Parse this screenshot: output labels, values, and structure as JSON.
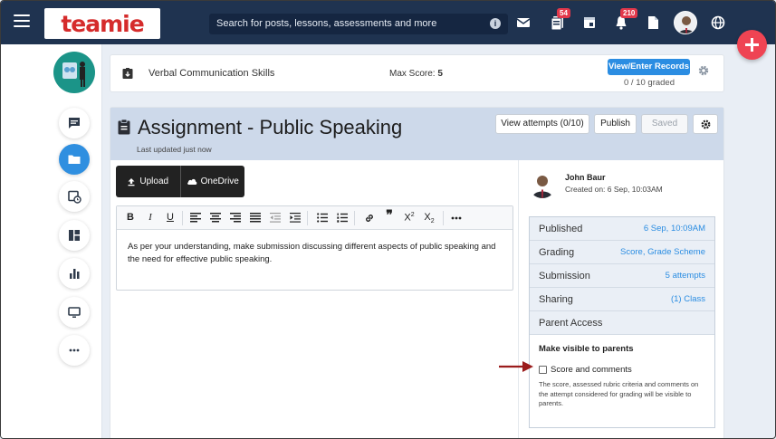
{
  "topbar": {
    "logo_text": "teamie",
    "search_placeholder": "Search for posts, lessons, assessments and more",
    "search_info_glyph": "i",
    "icons": [
      "menu-icon",
      "mail-icon",
      "posts-icon",
      "calendar-icon",
      "notifications-icon",
      "documents-icon",
      "globe-icon"
    ],
    "posts_badge": "54",
    "notifications_badge": "210"
  },
  "sidebar": {
    "items": [
      "messages-icon",
      "folder-icon",
      "schedule-icon",
      "dashboard-icon",
      "analytics-icon",
      "screen-icon",
      "more-icon"
    ],
    "active_item": "folder-icon"
  },
  "score_bar": {
    "title": "Verbal Communication Skills",
    "max_score_label": "Max Score:",
    "max_score_value": "5",
    "records_button": "View/Enter Records",
    "graded": "0 / 10 graded"
  },
  "assignment": {
    "title": "Assignment - Public Speaking",
    "updated": "Last updated just now",
    "buttons": {
      "view_attempts": "View attempts (0/10)",
      "publish": "Publish",
      "saved": "Saved"
    },
    "upload_label": "Upload",
    "onedrive_label": "OneDrive",
    "editor_text": "As per your understanding, make submission discussing different aspects of public speaking and the need for effective public speaking."
  },
  "details": {
    "teacher_name": "John Baur",
    "created": "Created on: 6 Sep, 10:03AM",
    "rows": [
      {
        "key": "Published",
        "value": "6 Sep, 10:09AM"
      },
      {
        "key": "Grading",
        "value": "Score, Grade Scheme"
      },
      {
        "key": "Submission",
        "value": "5 attempts"
      },
      {
        "key": "Sharing",
        "value": "(1) Class"
      },
      {
        "key": "Parent Access",
        "value": ""
      }
    ],
    "parent_access": {
      "heading": "Make visible to parents",
      "checkbox_label": "Score and comments",
      "checked": false,
      "note": "The score, assessed rubric criteria and comments on the attempt considered for grading will be visible to parents."
    }
  },
  "colors": {
    "nav_bg": "#1f3350",
    "accent_blue": "#2b8de2",
    "fab_red": "#ef4453",
    "header_blue": "#cdd9ea",
    "arrow_red": "#9b1c1c"
  }
}
